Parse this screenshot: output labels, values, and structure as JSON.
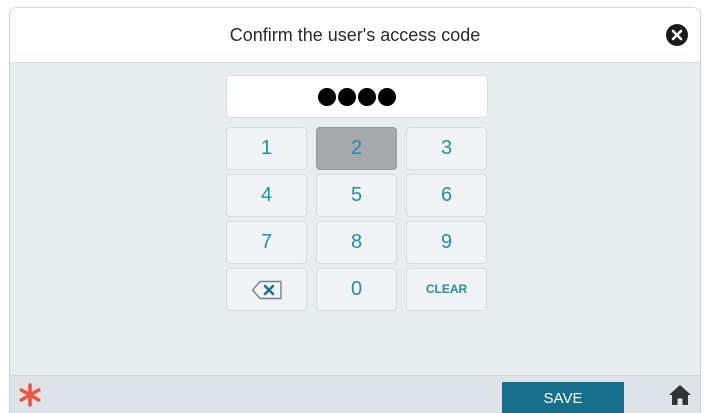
{
  "dialog": {
    "title": "Confirm the user's access code"
  },
  "code_display": {
    "masked_value": "●●●●",
    "digit_count": 4
  },
  "keypad": {
    "keys": [
      "1",
      "2",
      "3",
      "4",
      "5",
      "6",
      "7",
      "8",
      "9",
      "backspace",
      "0",
      "CLEAR"
    ],
    "pressed_key": "2"
  },
  "footer": {
    "save_label": "SAVE"
  },
  "icons": {
    "close": "close-icon",
    "backspace": "backspace-icon",
    "asterisk": "asterisk-icon",
    "home": "home-icon"
  },
  "colors": {
    "accent": "#156f8b",
    "key_text": "#1e8fb0",
    "asterisk": "#f0533f",
    "pressed_key": "#a6a9ab"
  }
}
